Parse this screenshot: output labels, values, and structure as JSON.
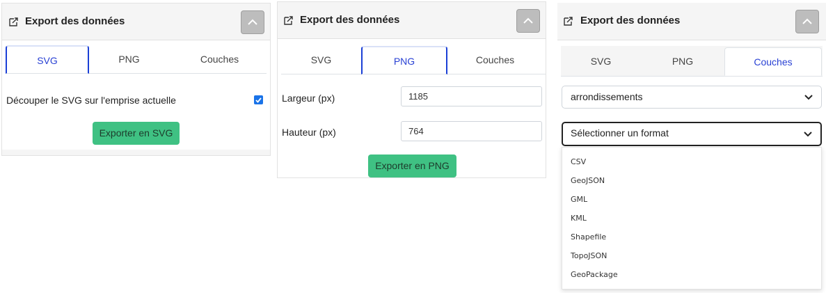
{
  "header_title": "Export des données",
  "tabs": [
    "SVG",
    "PNG",
    "Couches"
  ],
  "svg_panel": {
    "clip_label": "Découper le SVG sur l'emprise actuelle",
    "clip_checked": true,
    "export_button": "Exporter en SVG"
  },
  "png_panel": {
    "width_label": "Largeur (px)",
    "width_value": "1185",
    "height_label": "Hauteur (px)",
    "height_value": "764",
    "export_button": "Exporter en PNG"
  },
  "layers_panel": {
    "layer_select_value": "arrondissements",
    "format_select_placeholder": "Sélectionner un format",
    "format_options": [
      "CSV",
      "GeoJSON",
      "GML",
      "KML",
      "Shapefile",
      "TopoJSON",
      "GeoPackage"
    ]
  },
  "colors": {
    "accent_blue": "#2941d4",
    "button_green": "#3fc183",
    "checkbox_blue": "#1a73e8"
  },
  "icons": {
    "export": "export-icon",
    "collapse": "chevron-up-icon",
    "select": "chevron-down-icon"
  }
}
